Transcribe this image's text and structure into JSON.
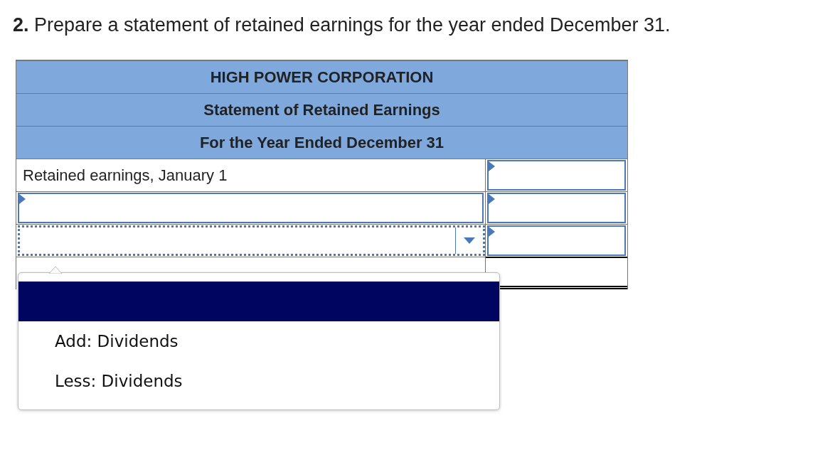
{
  "question": {
    "number": "2.",
    "text": "Prepare a statement of retained earnings for the year ended December 31."
  },
  "statement": {
    "headers": [
      "HIGH POWER CORPORATION",
      "Statement of Retained Earnings",
      "For the Year Ended December 31"
    ],
    "rows": [
      {
        "label": {
          "kind": "text",
          "text": "Retained earnings, January 1"
        },
        "amount": {
          "kind": "input"
        }
      },
      {
        "label": {
          "kind": "input"
        },
        "amount": {
          "kind": "input"
        }
      },
      {
        "label": {
          "kind": "select",
          "expanded": true
        },
        "amount": {
          "kind": "input"
        }
      },
      {
        "label": {
          "kind": "covered"
        },
        "amount": {
          "kind": "total"
        }
      }
    ]
  },
  "dropdown": {
    "options": [
      {
        "selected": true
      },
      {
        "label": "Add: Dividends",
        "selected": false
      },
      {
        "label": "Less: Dividends",
        "selected": false
      }
    ]
  }
}
